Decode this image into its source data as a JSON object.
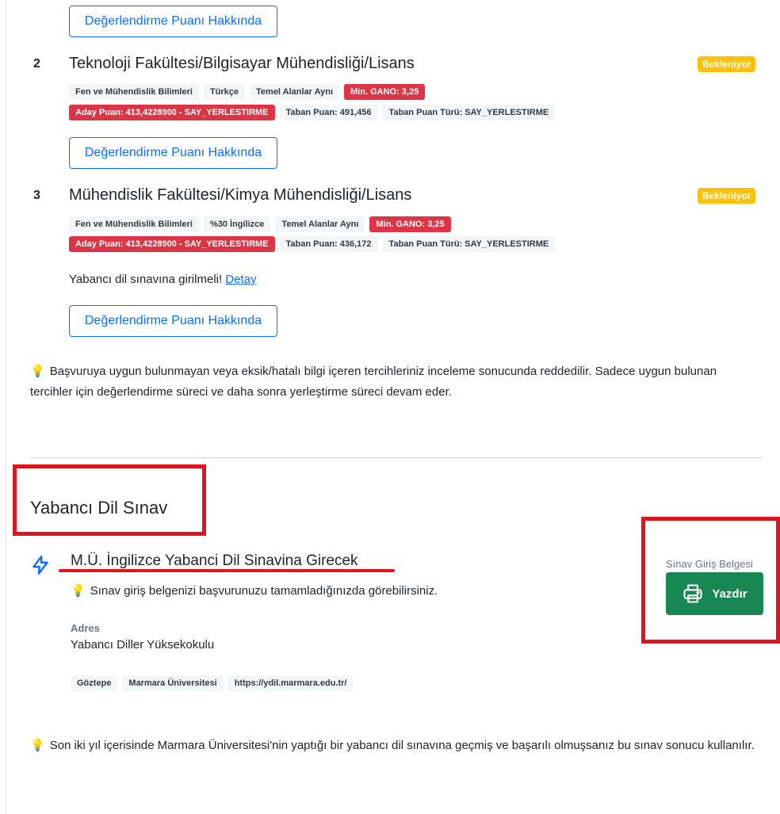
{
  "eval_button_label": "Değerlendirme Puanı Hakkında",
  "programs": [
    {
      "number": "2",
      "title": "Teknoloji Fakültesi/Bilgisayar Mühendisliği/Lisans",
      "status": "Bekleniyor",
      "tags_row1": [
        "Fen ve Mühendislik Bilimleri",
        "Türkçe",
        "Temel Alanlar Aynı",
        "Min. GANO: 3,25"
      ],
      "tags_row2": [
        "Aday Puan: 413,4228900 - SAY_YERLESTIRME",
        "Taban Puan: 491,456",
        "Taban Puan Türü: SAY_YERLESTIRME"
      ]
    },
    {
      "number": "3",
      "title": "Mühendislik Fakültesi/Kimya Mühendisliği/Lisans",
      "status": "Bekleniyor",
      "tags_row1": [
        "Fen ve Mühendislik Bilimleri",
        "%30 İngilizce",
        "Temel Alanlar Aynı",
        "Min. GANO: 3,25"
      ],
      "tags_row2": [
        "Aday Puan: 413,4228900 - SAY_YERLESTIRME",
        "Taban Puan: 436,172",
        "Taban Puan Türü: SAY_YERLESTIRME"
      ],
      "language_note": "Yabancı dil sınavına girilmeli!",
      "language_link": "Detay"
    }
  ],
  "info_note_1": "Başvuruya uygun bulunmayan veya eksik/hatalı bilgi içeren tercihleriniz inceleme sonucunda reddedilir. Sadece uygun bulunan tercihler için değerlendirme süreci ve daha sonra yerleştirme süreci devam eder.",
  "section": {
    "title": "Yabancı Dil Sınav",
    "exam_title": "M.Ü. İngilizce Yabanci Dil Sinavina Girecek",
    "exam_note": "Sınav giriş belgenizi başvurunuzu tamamladığınızda görebilirsiniz.",
    "address_label": "Adres",
    "address_value": "Yabancı Diller Yüksekokulu",
    "address_tags": [
      "Göztepe",
      "Marmara Üniversitesi",
      "https://ydil.marmara.edu.tr/"
    ],
    "document_label": "Sınav Giriş Belgesi",
    "print_label": "Yazdır",
    "info_note_2": "Son iki yıl içerisinde Marmara Üniversitesi'nin yaptığı bir yabancı dil sınavına geçmiş ve başarılı olmuşsanız bu sınav sonucu kullanılır."
  },
  "colors": {
    "primary": "#0d6efd",
    "warning": "#ffc107",
    "danger": "#dc3545",
    "success": "#198754",
    "annotation_red": "#e0141e"
  },
  "icons": [
    "lightbulb-icon",
    "lightning-icon",
    "printer-icon"
  ]
}
